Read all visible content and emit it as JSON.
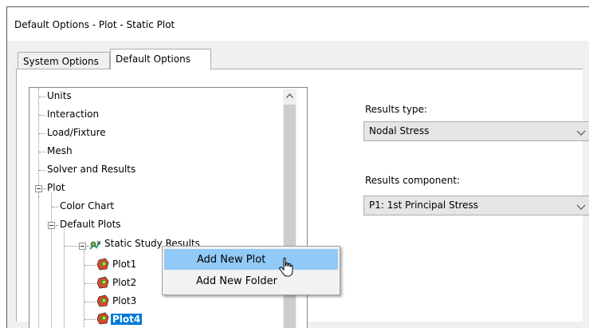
{
  "window": {
    "title": "Default Options - Plot - Static Plot"
  },
  "tabs": [
    {
      "label": "System Options",
      "active": false
    },
    {
      "label": "Default Options",
      "active": true
    }
  ],
  "tree": {
    "items": [
      {
        "label": "Units"
      },
      {
        "label": "Interaction"
      },
      {
        "label": "Load/Fixture"
      },
      {
        "label": "Mesh"
      },
      {
        "label": "Solver and Results"
      },
      {
        "label": "Plot"
      },
      {
        "label": "Color Chart"
      },
      {
        "label": "Default Plots"
      },
      {
        "label": "Static Study Results"
      },
      {
        "label": "Plot1"
      },
      {
        "label": "Plot2"
      },
      {
        "label": "Plot3"
      },
      {
        "label": "Plot4",
        "selected": true
      }
    ],
    "selected_color": "#0078d7"
  },
  "context_menu": {
    "items": [
      {
        "label": "Add New Plot",
        "highlighted": true
      },
      {
        "label": "Add New Folder"
      }
    ],
    "highlight_color": "#91c9f7"
  },
  "results_type": {
    "label": "Results type:",
    "value": "Nodal Stress"
  },
  "results_component": {
    "label": "Results component:",
    "value": "P1: 1st Principal Stress"
  }
}
